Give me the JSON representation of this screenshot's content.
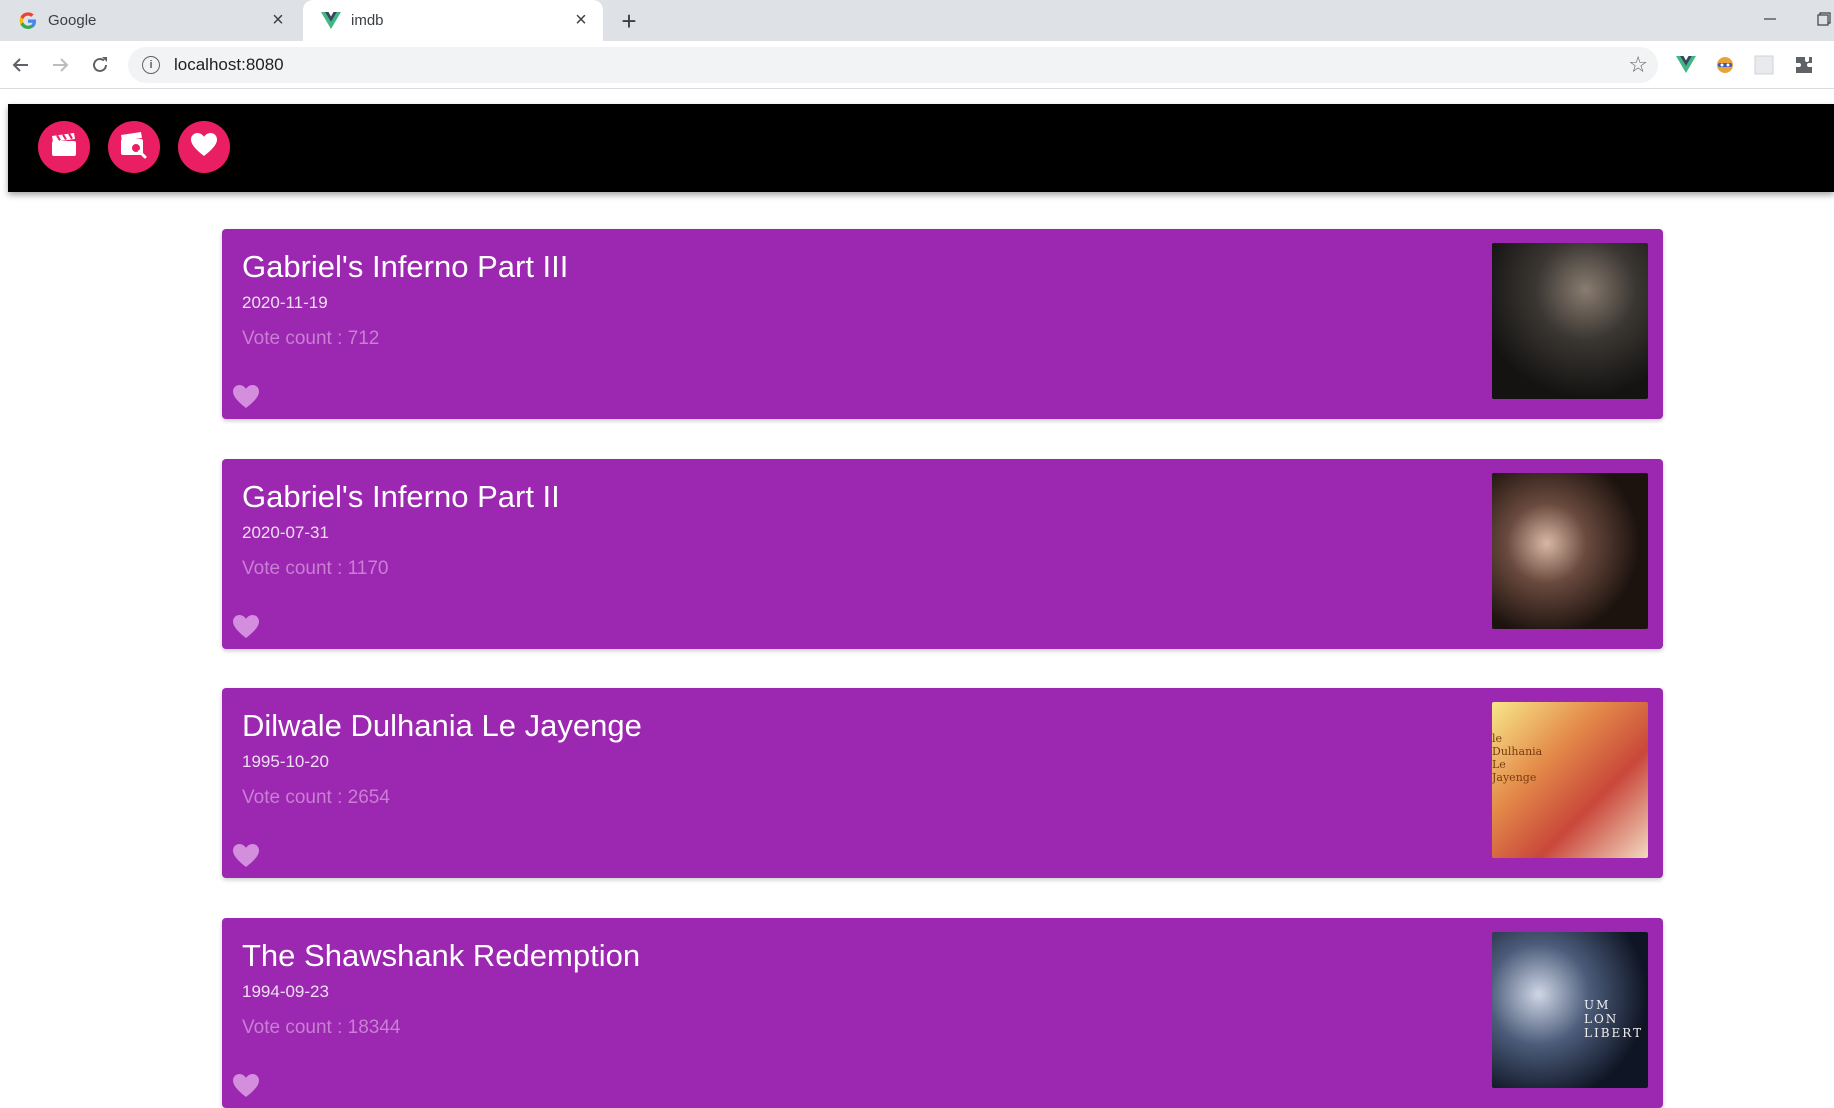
{
  "browser": {
    "tabs": [
      {
        "label": "Google",
        "active": false,
        "favicon": "google-g-icon"
      },
      {
        "label": "imdb",
        "active": true,
        "favicon": "vue-logo-icon"
      }
    ],
    "new_tab": "+",
    "address": "localhost:8080"
  },
  "app": {
    "nav_buttons": [
      {
        "icon": "clapperboard-icon"
      },
      {
        "icon": "movie-search-icon"
      },
      {
        "icon": "heart-icon"
      }
    ],
    "accent_color": "#e91e63",
    "card_color": "#9c27b0"
  },
  "movies": [
    {
      "title": "Gabriel's Inferno Part III",
      "date": "2020-11-19",
      "votes": "Vote count : 712",
      "favorite": false
    },
    {
      "title": "Gabriel's Inferno Part II",
      "date": "2020-07-31",
      "votes": "Vote count : 1170",
      "favorite": false
    },
    {
      "title": "Dilwale Dulhania Le Jayenge",
      "date": "1995-10-20",
      "votes": "Vote count : 2654",
      "favorite": false,
      "poster_text": "le Dulhania Le Jayenge"
    },
    {
      "title": "The Shawshank Redemption",
      "date": "1994-09-23",
      "votes": "Vote count : 18344",
      "favorite": false,
      "poster_text": "UM LON LIBERT"
    }
  ]
}
